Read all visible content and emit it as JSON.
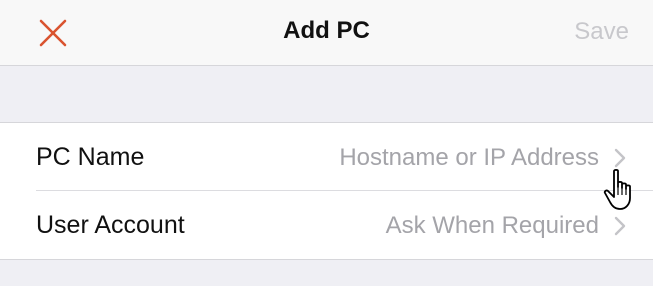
{
  "navbar": {
    "title": "Add PC",
    "save_label": "Save",
    "close_icon": "close-x-icon",
    "accent_color": "#d9532f"
  },
  "rows": [
    {
      "label": "PC Name",
      "value": "Hostname or IP Address",
      "icon": "chevron-right-icon"
    },
    {
      "label": "User Account",
      "value": "Ask When Required",
      "icon": "chevron-right-icon"
    }
  ],
  "cursor": {
    "icon": "hand-pointer-icon"
  }
}
